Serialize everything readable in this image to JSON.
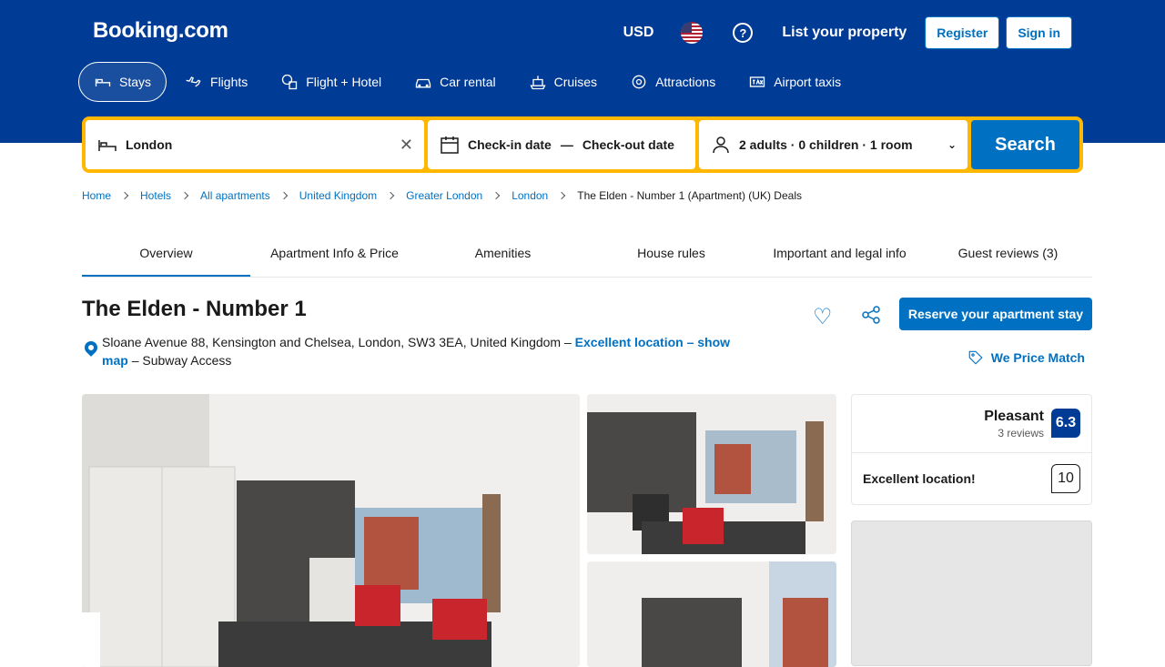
{
  "header": {
    "logo": "Booking.com",
    "currency": "USD",
    "help_icon": "?",
    "list_property": "List your property",
    "register": "Register",
    "sign_in": "Sign in"
  },
  "tabs": [
    {
      "label": "Stays",
      "icon": "bed-icon",
      "active": true
    },
    {
      "label": "Flights",
      "icon": "plane-icon"
    },
    {
      "label": "Flight + Hotel",
      "icon": "flight-hotel-icon"
    },
    {
      "label": "Car rental",
      "icon": "car-icon"
    },
    {
      "label": "Cruises",
      "icon": "ship-icon"
    },
    {
      "label": "Attractions",
      "icon": "attractions-icon"
    },
    {
      "label": "Airport taxis",
      "icon": "taxi-icon"
    }
  ],
  "search": {
    "destination": "London",
    "checkin": "Check-in date",
    "dash": "—",
    "checkout": "Check-out date",
    "guests": "2 adults · 0 children · 1 room",
    "button": "Search"
  },
  "breadcrumb": [
    "Home",
    "Hotels",
    "All apartments",
    "United Kingdom",
    "Greater London",
    "London"
  ],
  "breadcrumb_last": "The Elden - Number 1 (Apartment) (UK) Deals",
  "page_tabs": [
    "Overview",
    "Apartment Info & Price",
    "Amenities",
    "House rules",
    "Important and legal info",
    "Guest reviews (3)"
  ],
  "property": {
    "title": "The Elden - Number 1",
    "address": "Sloane Avenue 88, Kensington and Chelsea, London, SW3 3EA, United Kingdom –",
    "location_link": "Excellent location – show map",
    "address_tail": "– Subway Access",
    "reserve": "Reserve your apartment stay",
    "price_match": "We Price Match"
  },
  "rating": {
    "word": "Pleasant",
    "reviews": "3 reviews",
    "score": "6.3",
    "location_label": "Excellent location!",
    "location_score": "10"
  },
  "colors": {
    "brand": "#003b95",
    "accent": "#0071c2",
    "search_border": "#ffb700"
  }
}
